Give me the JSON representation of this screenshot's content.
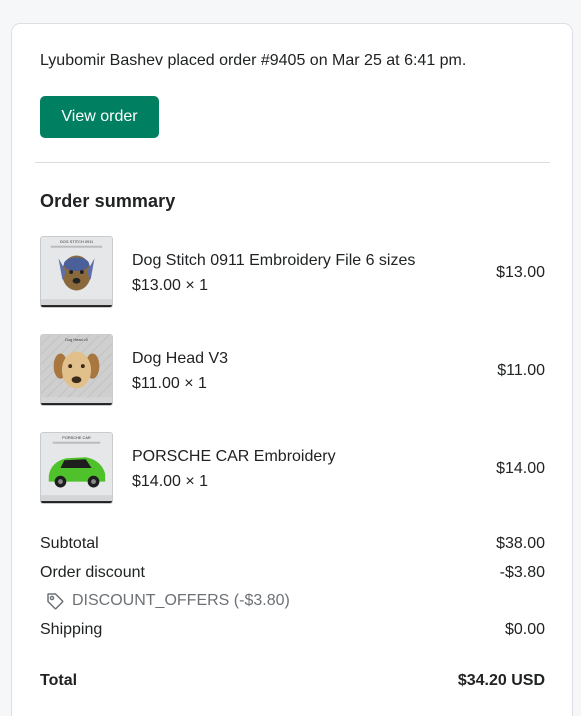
{
  "notification": {
    "headline": "Lyubomir Bashev placed order #9405 on Mar 25 at 6:41 pm.",
    "view_order_label": "View order"
  },
  "summary": {
    "title": "Order summary",
    "items": [
      {
        "name": "Dog Stitch 0911 Embroidery File 6 sizes",
        "qty_line": "$13.00 × 1",
        "price": "$13.00",
        "thumb_caption": "DOG STITCH 0911"
      },
      {
        "name": "Dog Head V3",
        "qty_line": "$11.00 × 1",
        "price": "$11.00",
        "thumb_caption": "Dog Head v3"
      },
      {
        "name": "PORSCHE CAR Embroidery",
        "qty_line": "$14.00 × 1",
        "price": "$14.00",
        "thumb_caption": "PORSCHE CAR"
      }
    ],
    "subtotal_label": "Subtotal",
    "subtotal_value": "$38.00",
    "discount_label": "Order discount",
    "discount_value": "-$3.80",
    "discount_code": "DISCOUNT_OFFERS (-$3.80)",
    "shipping_label": "Shipping",
    "shipping_value": "$0.00",
    "total_label": "Total",
    "total_value": "$34.20 USD"
  },
  "colors": {
    "accent": "#008060",
    "muted_text": "#6d7175"
  },
  "icons": {
    "discount": "tag-icon"
  }
}
